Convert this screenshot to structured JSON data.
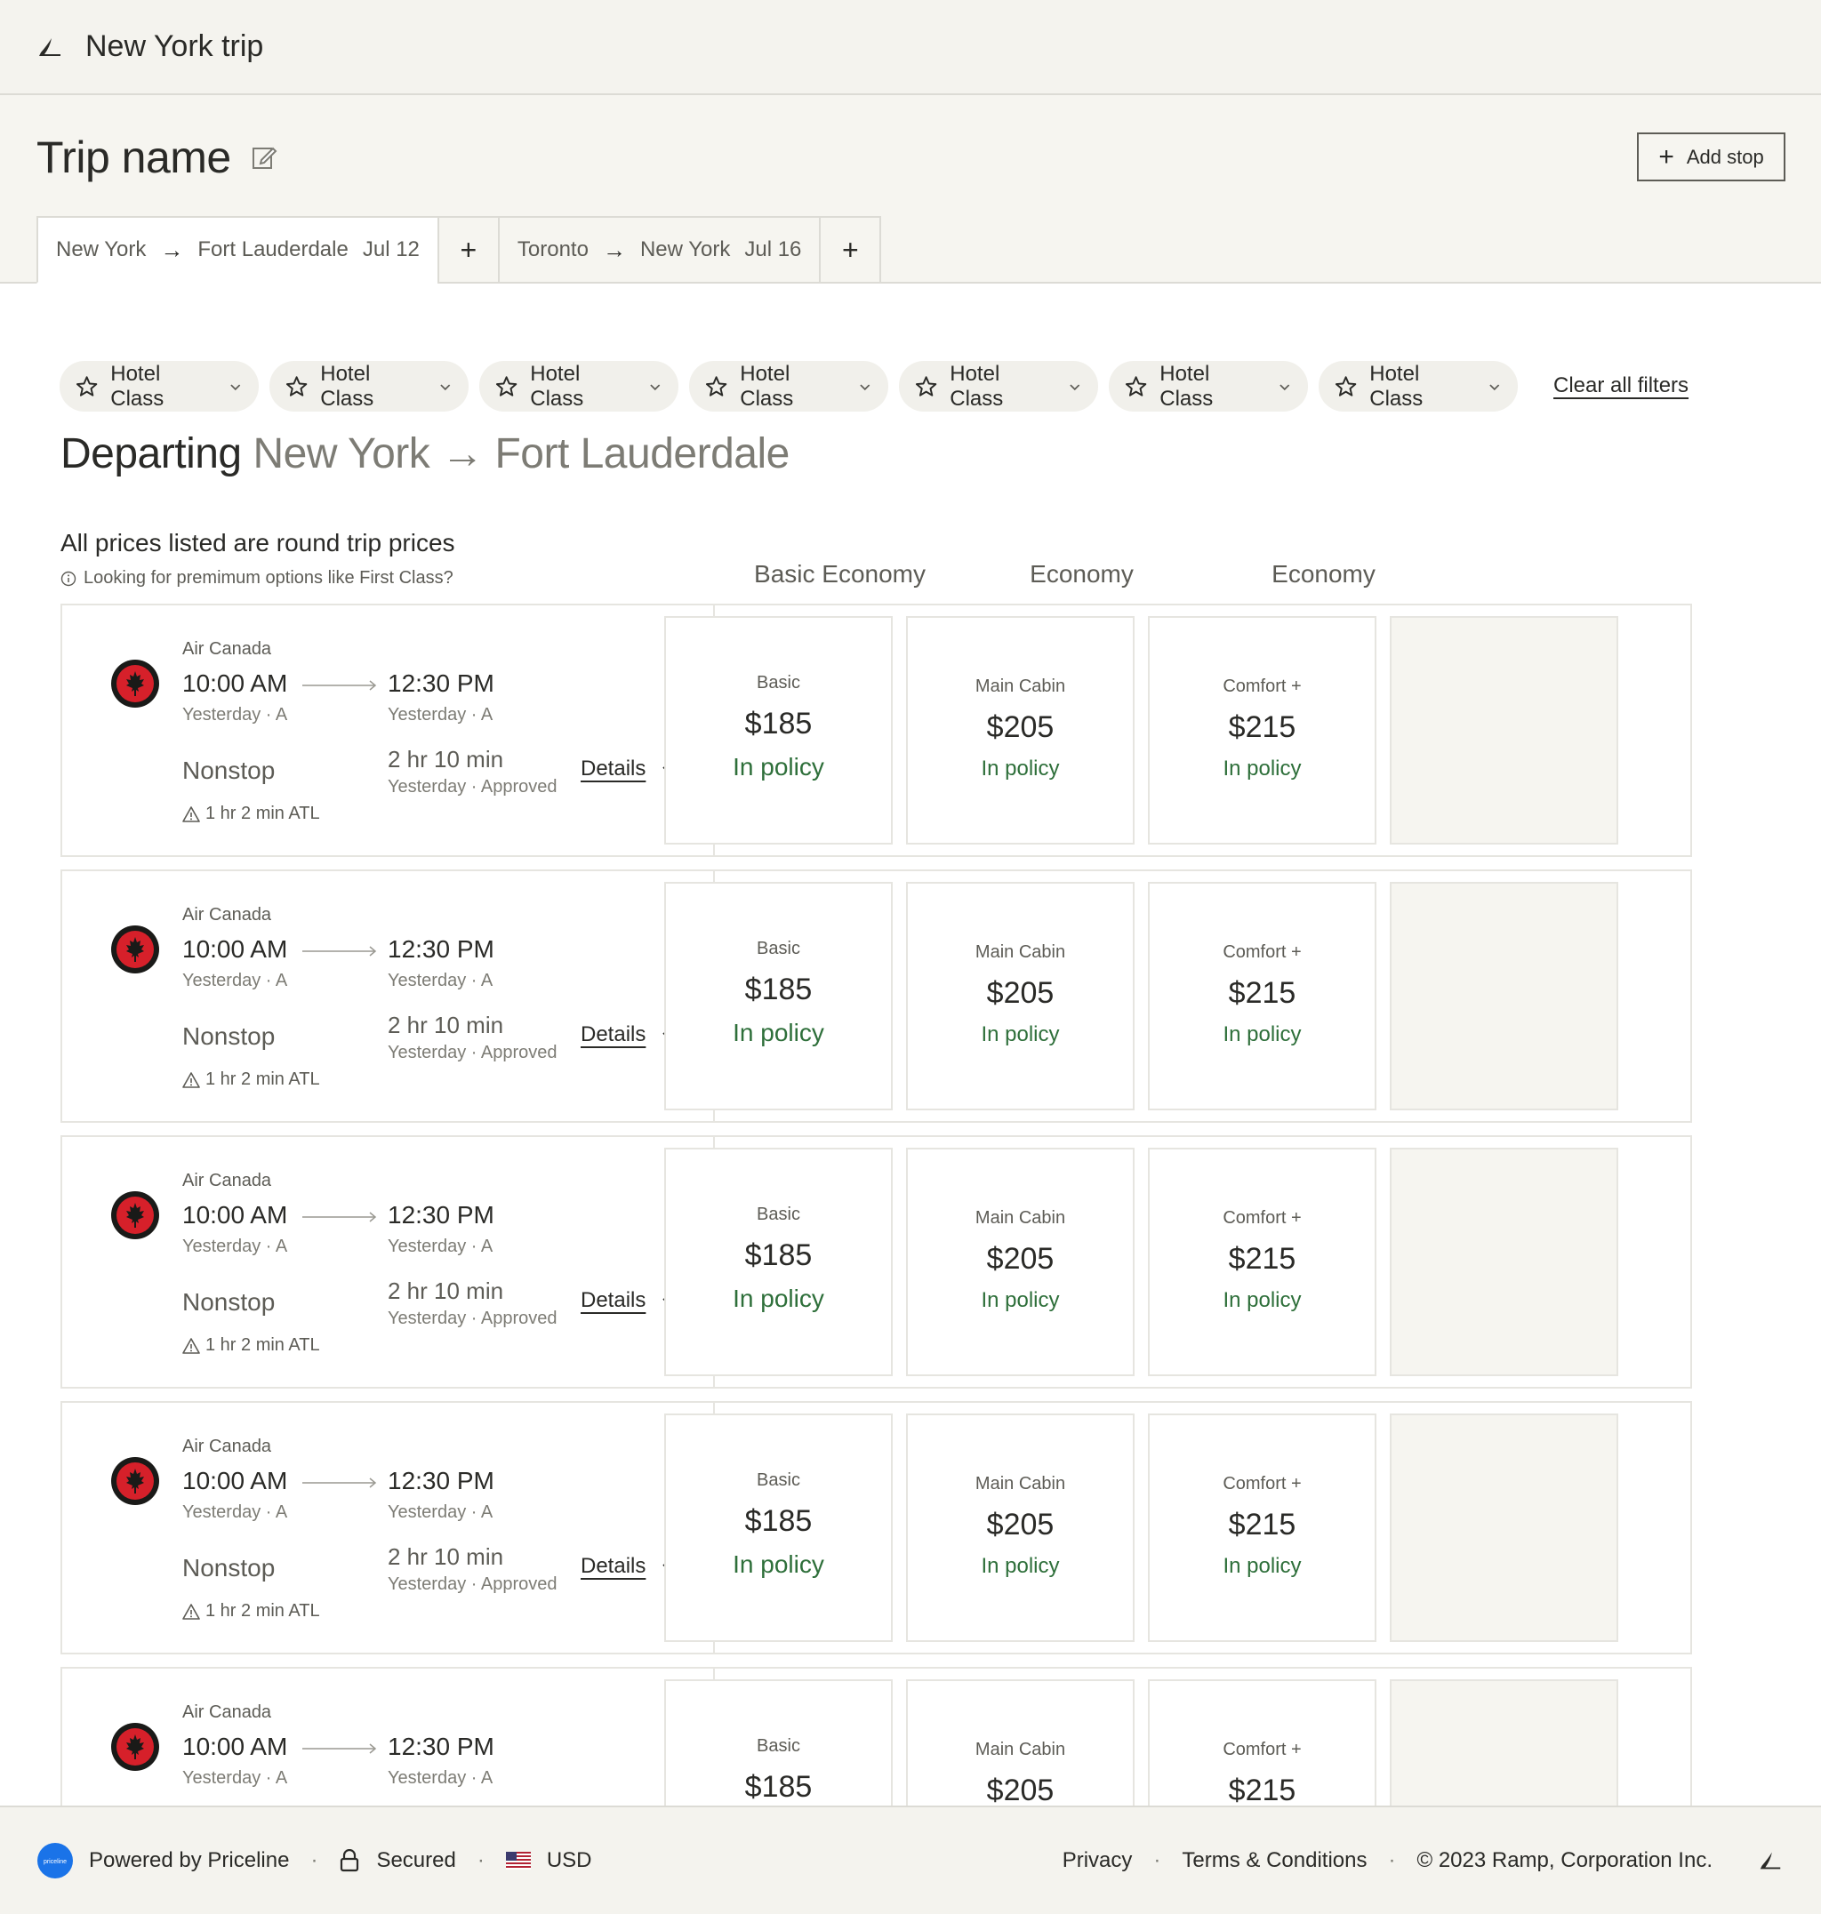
{
  "app": {
    "title": "New York trip"
  },
  "trip": {
    "name": "Trip name",
    "add_stop_label": "Add stop"
  },
  "tabs": [
    {
      "from": "New York",
      "to": "Fort Lauderdale",
      "date": "Jul 12",
      "active": true
    },
    {
      "from": "Toronto",
      "to": "New York",
      "date": "Jul 16",
      "active": false
    }
  ],
  "tab_add_label": "+",
  "filters": {
    "chips": [
      "Hotel Class",
      "Hotel Class",
      "Hotel Class",
      "Hotel Class",
      "Hotel Class",
      "Hotel Class",
      "Hotel Class"
    ],
    "clear_label": "Clear all filters"
  },
  "heading": {
    "label": "Departing",
    "from": "New York",
    "arrow": "→",
    "to": "Fort Lauderdale"
  },
  "notes": {
    "prices": "All prices listed are round trip prices",
    "premium": "Looking for premimum options like First Class?"
  },
  "columns": [
    "Basic Economy",
    "Economy",
    "Economy"
  ],
  "flights": [
    {
      "airline": "Air Canada",
      "dep_time": "10:00 AM",
      "arr_time": "12:30 PM",
      "dep_sub": "Yesterday · A",
      "arr_sub": "Yesterday · A",
      "stops": "Nonstop",
      "duration": "2 hr 10 min",
      "duration_sub": "Yesterday · Approved",
      "layover": "1 hr 2 min ATL",
      "details_label": "Details",
      "fares": [
        {
          "name": "Basic",
          "price": "$185",
          "policy": "In policy"
        },
        {
          "name": "Main Cabin",
          "price": "$205",
          "policy": "In policy"
        },
        {
          "name": "Comfort +",
          "price": "$215",
          "policy": "In policy"
        }
      ]
    },
    {
      "airline": "Air Canada",
      "dep_time": "10:00 AM",
      "arr_time": "12:30 PM",
      "dep_sub": "Yesterday · A",
      "arr_sub": "Yesterday · A",
      "stops": "Nonstop",
      "duration": "2 hr 10 min",
      "duration_sub": "Yesterday · Approved",
      "layover": "1 hr 2 min ATL",
      "details_label": "Details",
      "fares": [
        {
          "name": "Basic",
          "price": "$185",
          "policy": "In policy"
        },
        {
          "name": "Main Cabin",
          "price": "$205",
          "policy": "In policy"
        },
        {
          "name": "Comfort +",
          "price": "$215",
          "policy": "In policy"
        }
      ]
    },
    {
      "airline": "Air Canada",
      "dep_time": "10:00 AM",
      "arr_time": "12:30 PM",
      "dep_sub": "Yesterday · A",
      "arr_sub": "Yesterday · A",
      "stops": "Nonstop",
      "duration": "2 hr 10 min",
      "duration_sub": "Yesterday · Approved",
      "layover": "1 hr 2 min ATL",
      "details_label": "Details",
      "fares": [
        {
          "name": "Basic",
          "price": "$185",
          "policy": "In policy"
        },
        {
          "name": "Main Cabin",
          "price": "$205",
          "policy": "In policy"
        },
        {
          "name": "Comfort +",
          "price": "$215",
          "policy": "In policy"
        }
      ]
    },
    {
      "airline": "Air Canada",
      "dep_time": "10:00 AM",
      "arr_time": "12:30 PM",
      "dep_sub": "Yesterday · A",
      "arr_sub": "Yesterday · A",
      "stops": "Nonstop",
      "duration": "2 hr 10 min",
      "duration_sub": "Yesterday · Approved",
      "layover": "1 hr 2 min ATL",
      "details_label": "Details",
      "fares": [
        {
          "name": "Basic",
          "price": "$185",
          "policy": "In policy"
        },
        {
          "name": "Main Cabin",
          "price": "$205",
          "policy": "In policy"
        },
        {
          "name": "Comfort +",
          "price": "$215",
          "policy": "In policy"
        }
      ]
    },
    {
      "airline": "Air Canada",
      "dep_time": "10:00 AM",
      "arr_time": "12:30 PM",
      "dep_sub": "Yesterday · A",
      "arr_sub": "Yesterday · A",
      "stops": "",
      "duration": "",
      "duration_sub": "",
      "layover": "",
      "details_label": "",
      "fares": [
        {
          "name": "Basic",
          "price": "$185",
          "policy": ""
        },
        {
          "name": "Main Cabin",
          "price": "$205",
          "policy": ""
        },
        {
          "name": "Comfort +",
          "price": "$215",
          "policy": ""
        }
      ]
    }
  ],
  "footer": {
    "powered_by": "Powered by Priceline",
    "secured": "Secured",
    "currency": "USD",
    "privacy": "Privacy",
    "terms": "Terms & Conditions",
    "copyright": "© 2023 Ramp, Corporation Inc."
  },
  "colors": {
    "policy_green": "#2e6f3a",
    "airline_red": "#d6202a",
    "priceline_blue": "#1a73e8"
  },
  "icons": [
    "plane-logo-icon",
    "edit-pencil-icon",
    "plus-icon",
    "arrow-right-icon",
    "star-icon",
    "chevron-down-icon",
    "info-icon",
    "maple-leaf-icon",
    "warning-icon",
    "lock-icon",
    "us-flag-icon"
  ]
}
